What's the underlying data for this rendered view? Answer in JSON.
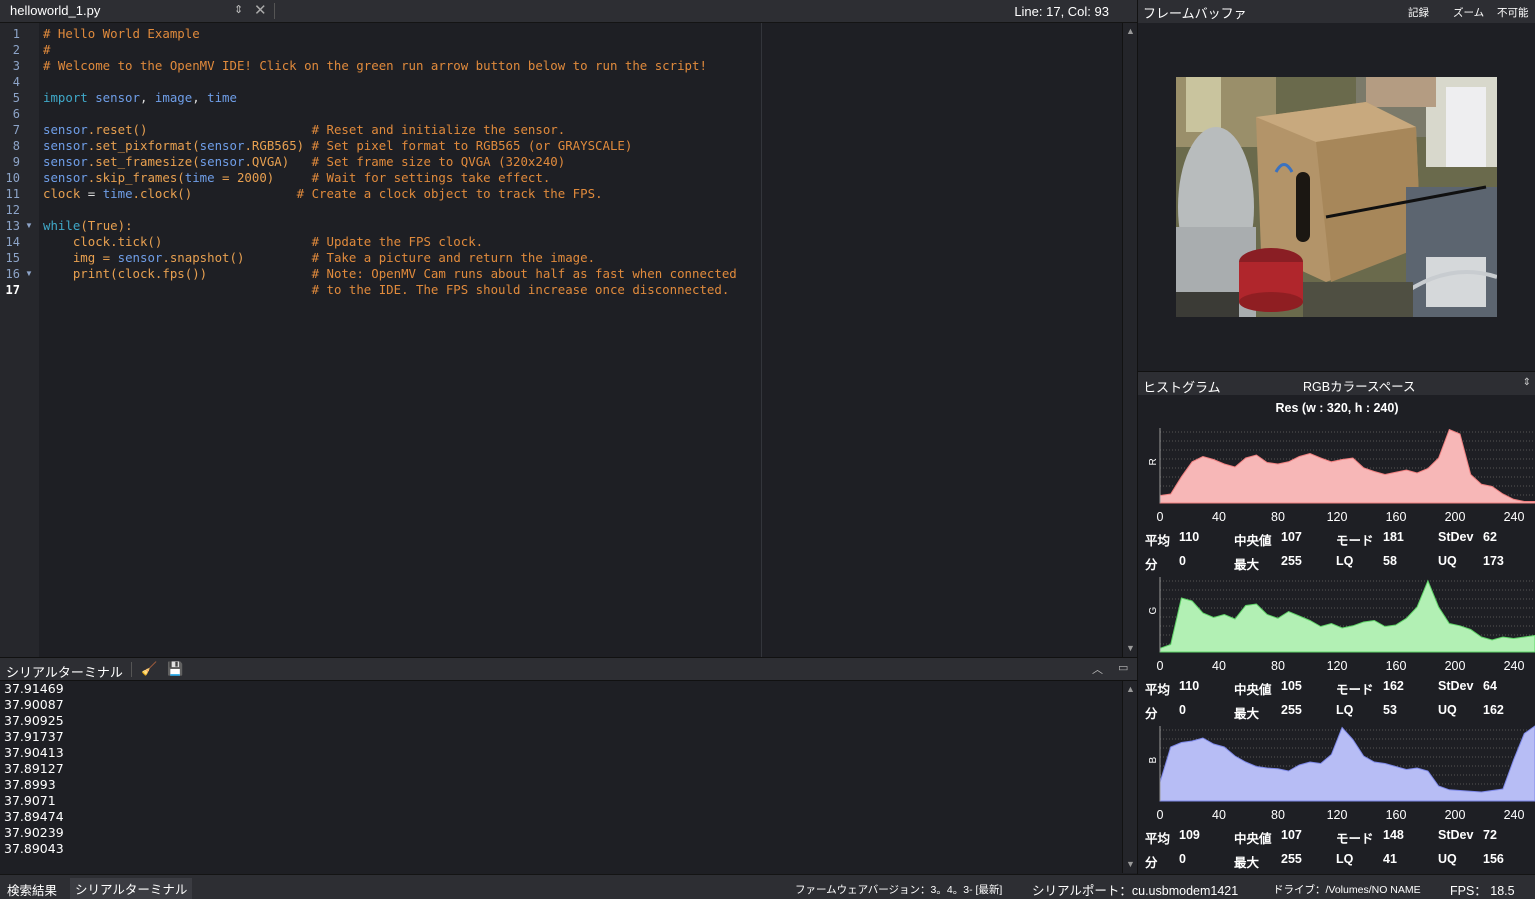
{
  "editor": {
    "filename": "helloworld_1.py",
    "position": "Line: 17, Col: 93",
    "lines": [
      [
        {
          "t": "# Hello World Example",
          "c": "c"
        }
      ],
      [
        {
          "t": "#",
          "c": "c"
        }
      ],
      [
        {
          "t": "# Welcome to the OpenMV IDE! Click on the green run arrow button below to run the script!",
          "c": "c"
        }
      ],
      [],
      [
        {
          "t": "import ",
          "c": "k"
        },
        {
          "t": "sensor",
          "c": "v"
        },
        {
          "t": ", ",
          "c": "p"
        },
        {
          "t": "image",
          "c": "v"
        },
        {
          "t": ", ",
          "c": "p"
        },
        {
          "t": "time",
          "c": "v"
        }
      ],
      [],
      [
        {
          "t": "sensor",
          "c": "v"
        },
        {
          "t": ".reset()",
          "c": "n"
        },
        {
          "t": "                      ",
          "c": "p"
        },
        {
          "t": "# Reset and initialize the sensor.",
          "c": "c"
        }
      ],
      [
        {
          "t": "sensor",
          "c": "v"
        },
        {
          "t": ".set_pixformat(",
          "c": "n"
        },
        {
          "t": "sensor",
          "c": "v"
        },
        {
          "t": ".RGB565) ",
          "c": "n"
        },
        {
          "t": "# Set pixel format to RGB565 (or GRAYSCALE)",
          "c": "c"
        }
      ],
      [
        {
          "t": "sensor",
          "c": "v"
        },
        {
          "t": ".set_framesize(",
          "c": "n"
        },
        {
          "t": "sensor",
          "c": "v"
        },
        {
          "t": ".QVGA)   ",
          "c": "n"
        },
        {
          "t": "# Set frame size to QVGA (320x240)",
          "c": "c"
        }
      ],
      [
        {
          "t": "sensor",
          "c": "v"
        },
        {
          "t": ".skip_frames(",
          "c": "n"
        },
        {
          "t": "time",
          "c": "v"
        },
        {
          "t": " = 2000)     ",
          "c": "n"
        },
        {
          "t": "# Wait for settings take effect.",
          "c": "c"
        }
      ],
      [
        {
          "t": "clock",
          "c": "n"
        },
        {
          "t": " = ",
          "c": "p"
        },
        {
          "t": "time",
          "c": "v"
        },
        {
          "t": ".clock()",
          "c": "n"
        },
        {
          "t": "              ",
          "c": "p"
        },
        {
          "t": "# Create a clock object to track the FPS.",
          "c": "c"
        }
      ],
      [],
      [
        {
          "t": "while",
          "c": "k"
        },
        {
          "t": "(True):",
          "c": "n"
        }
      ],
      [
        {
          "t": "    clock.tick()",
          "c": "n"
        },
        {
          "t": "                    ",
          "c": "p"
        },
        {
          "t": "# Update the FPS clock.",
          "c": "c"
        }
      ],
      [
        {
          "t": "    img = ",
          "c": "n"
        },
        {
          "t": "sensor",
          "c": "v"
        },
        {
          "t": ".snapshot()",
          "c": "n"
        },
        {
          "t": "         ",
          "c": "p"
        },
        {
          "t": "# Take a picture and return the image.",
          "c": "c"
        }
      ],
      [
        {
          "t": "    print(clock.fps())",
          "c": "n"
        },
        {
          "t": "              ",
          "c": "p"
        },
        {
          "t": "# Note: OpenMV Cam runs about half as fast when connected",
          "c": "c"
        }
      ],
      [
        {
          "t": "                                    ",
          "c": "p"
        },
        {
          "t": "# to the IDE. The FPS should increase once disconnected.",
          "c": "c"
        }
      ]
    ],
    "line_numbers": [
      "1",
      "2",
      "3",
      "4",
      "5",
      "6",
      "7",
      "8",
      "9",
      "10",
      "11",
      "12",
      "13",
      "14",
      "15",
      "16",
      "17"
    ]
  },
  "terminal": {
    "title": "シリアルターミナル",
    "lines": [
      "37.91469",
      "37.90087",
      "37.90925",
      "37.91737",
      "37.90413",
      "37.89127",
      "37.8993",
      "37.9071",
      "37.89474",
      "37.90239",
      "37.89043"
    ]
  },
  "framebuffer": {
    "title": "フレームバッファ",
    "buttons": [
      "記録",
      "ズーム",
      "不可能"
    ]
  },
  "histogram": {
    "title": "ヒストグラム",
    "colorspace": "RGBカラースペース",
    "resolution": "Res (w : 320, h : 240)",
    "ticks": [
      "0",
      "40",
      "80",
      "120",
      "160",
      "200",
      "240"
    ],
    "labels": {
      "mean": "平均",
      "median": "中央値",
      "mode": "モード",
      "stdev": "StDev",
      "min": "分",
      "max": "最大",
      "lq": "LQ",
      "uq": "UQ"
    },
    "channels": [
      {
        "name": "R",
        "color": "#f7b7b7",
        "stroke": "#f08080",
        "mean": "110",
        "median": "107",
        "mode": "181",
        "stdev": "62",
        "min": "0",
        "max": "255",
        "lq": "58",
        "uq": "173",
        "curve": [
          0.1,
          0.12,
          0.35,
          0.55,
          0.62,
          0.58,
          0.52,
          0.48,
          0.6,
          0.64,
          0.54,
          0.52,
          0.55,
          0.62,
          0.66,
          0.6,
          0.55,
          0.58,
          0.6,
          0.47,
          0.42,
          0.38,
          0.41,
          0.44,
          0.4,
          0.46,
          0.6,
          0.98,
          0.92,
          0.38,
          0.25,
          0.22,
          0.12,
          0.05,
          0.02,
          0.02
        ]
      },
      {
        "name": "G",
        "color": "#b2f0b4",
        "stroke": "#5fd468",
        "mean": "110",
        "median": "105",
        "mode": "162",
        "stdev": "64",
        "min": "0",
        "max": "255",
        "lq": "53",
        "uq": "162",
        "curve": [
          0.05,
          0.1,
          0.72,
          0.68,
          0.52,
          0.46,
          0.5,
          0.44,
          0.62,
          0.64,
          0.5,
          0.45,
          0.54,
          0.48,
          0.42,
          0.34,
          0.38,
          0.32,
          0.35,
          0.4,
          0.42,
          0.34,
          0.36,
          0.45,
          0.6,
          0.95,
          0.6,
          0.38,
          0.35,
          0.3,
          0.2,
          0.16,
          0.2,
          0.18,
          0.2,
          0.22
        ]
      },
      {
        "name": "B",
        "color": "#b7bdf5",
        "stroke": "#7d88e8",
        "mean": "109",
        "median": "107",
        "mode": "148",
        "stdev": "72",
        "min": "0",
        "max": "255",
        "lq": "41",
        "uq": "156",
        "curve": [
          0.25,
          0.72,
          0.78,
          0.8,
          0.84,
          0.76,
          0.72,
          0.6,
          0.52,
          0.46,
          0.44,
          0.43,
          0.4,
          0.48,
          0.52,
          0.5,
          0.62,
          0.98,
          0.82,
          0.6,
          0.52,
          0.5,
          0.46,
          0.42,
          0.44,
          0.4,
          0.2,
          0.15,
          0.14,
          0.13,
          0.12,
          0.14,
          0.16,
          0.55,
          0.9,
          1.0
        ]
      }
    ]
  },
  "status": {
    "search": "検索結果",
    "terminal": "シリアルターミナル",
    "firmware": "ファームウェアバージョン：3。4。3- [最新]",
    "port": "シリアルポート：cu.usbmodem1421",
    "drive": "ドライブ：/Volumes/NO NAME",
    "fps": "FPS：  18.5"
  }
}
